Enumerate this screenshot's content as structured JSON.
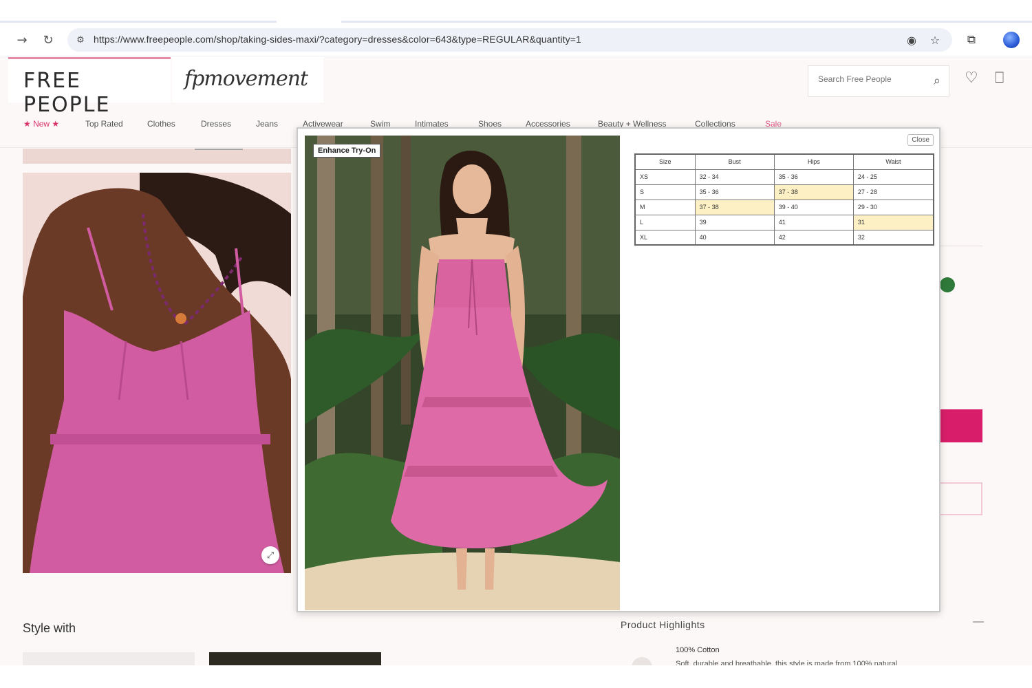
{
  "browser": {
    "url": "https://www.freepeople.com/shop/taking-sides-maxi/?category=dresses&color=643&type=REGULAR&quantity=1"
  },
  "site": {
    "brand": "FREE PEOPLE",
    "script_logo": "fpmovement",
    "search_placeholder": "Search Free People",
    "nav": [
      "★ New ★",
      "Top Rated",
      "Clothes",
      "Dresses",
      "Jeans",
      "Activewear",
      "Swim",
      "Intimates",
      "Shoes",
      "Accessories",
      "Beauty + Wellness",
      "Collections",
      "Sale"
    ]
  },
  "page": {
    "style_with": "Style with",
    "product_highlights": "Product Highlights",
    "highlight_title": "100% Cotton",
    "highlight_desc": "Soft, durable and breathable, this style is made from 100% natural",
    "collapse_symbol": "—"
  },
  "modal": {
    "tryon_label": "Enhance Try-On",
    "close_label": "Close",
    "size_chart": {
      "headers": [
        "Size",
        "Bust",
        "Hips",
        "Waist"
      ],
      "rows": [
        {
          "size": "XS",
          "bust": "32 - 34",
          "hips": "35 - 36",
          "waist": "24 - 25"
        },
        {
          "size": "S",
          "bust": "35 - 36",
          "hips": "37 - 38",
          "waist": "27 - 28"
        },
        {
          "size": "M",
          "bust": "37 - 38",
          "hips": "39 - 40",
          "waist": "29 - 30"
        },
        {
          "size": "L",
          "bust": "39",
          "hips": "41",
          "waist": "31"
        },
        {
          "size": "XL",
          "bust": "40",
          "hips": "42",
          "waist": "32"
        }
      ]
    }
  },
  "colors": {
    "accent_pink": "#d81e6a",
    "highlight_cell": "#fdf0c4",
    "nav_new": "#d9326b"
  }
}
